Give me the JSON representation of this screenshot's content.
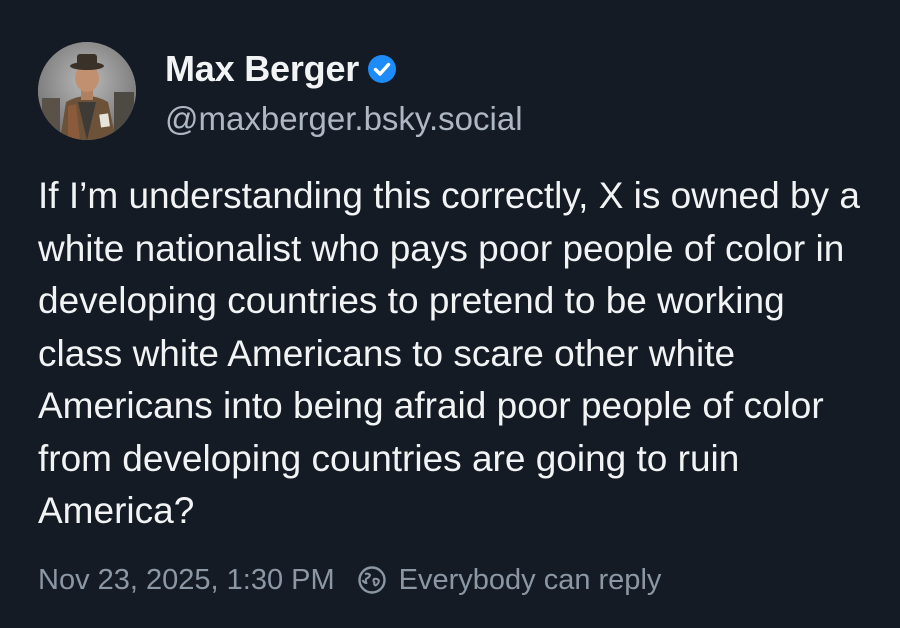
{
  "author": {
    "display_name": "Max Berger",
    "handle": "@maxberger.bsky.social",
    "verified": true
  },
  "post": {
    "text": "If I’m understanding this correctly, X is owned by a white nationalist who pays poor people of color in developing countries to pretend to be working class white Americans to scare other white Americans into being afraid poor people of color from developing countries are going to ruin America?"
  },
  "meta": {
    "timestamp": "Nov 23, 2025, 1:30 PM",
    "reply_setting": "Everybody can reply"
  },
  "icons": {
    "verified": "verified-badge-icon",
    "reply_setting": "globe-icon"
  },
  "colors": {
    "background": "#151b24",
    "text_primary": "#f1f3f5",
    "text_secondary": "#aeb8c4",
    "text_meta": "#8b97a4",
    "verified_blue": "#1d8cf8"
  }
}
